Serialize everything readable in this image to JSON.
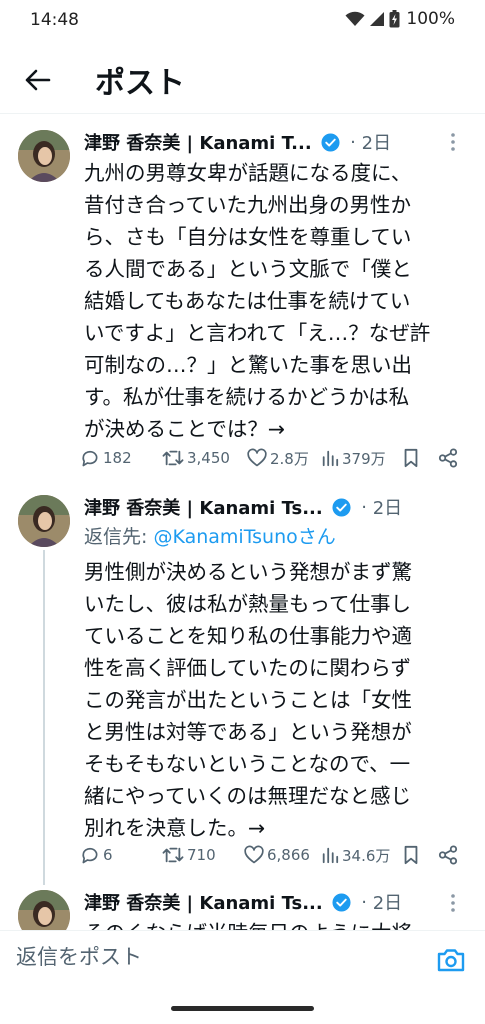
{
  "status_bar": {
    "time": "14:48",
    "battery": "100%"
  },
  "header": {
    "title": "ポスト"
  },
  "tweets": [
    {
      "author": "津野 香奈美 | Kanami T...",
      "time": "2日",
      "body": "九州の男尊女卑が話題になる度に、\n昔付き合っていた九州出身の男性か\nら、さも「自分は女性を尊重してい\nる人間である」という文脈で「僕と\n結婚してもあなたは仕事を続けてい\nいですよ」と言われて「え…？なぜ許\n可制なの…？」と驚いた事を思い出\nす。私が仕事を続けるかどうかは私\nが決めることでは？→",
      "replies": "182",
      "reposts": "3,450",
      "likes": "2.8万",
      "views": "379万"
    },
    {
      "author": "津野 香奈美 | Kanami Ts...",
      "time": "2日",
      "reply_prefix": "返信先: ",
      "reply_handle": "@KanamiTsunoさん",
      "body": "男性側が決めるという発想がまず驚\nいたし、彼は私が熱量もって仕事し\nていることを知り私の仕事能力や適\n性を高く評価していたのに関わらず\nこの発言が出たということは「女性\nと男性は対等である」という発想が\nそもそもないということなので、一\n緒にやっていくのは無理だなと感じ\n別れを決意した。→",
      "replies": "6",
      "reposts": "710",
      "likes": "6,866",
      "views": "34.6万"
    },
    {
      "author": "津野 香奈美 | Kanami Ts...",
      "time": "2日",
      "body_partial": "そのくならば当時毎日のように大将"
    }
  ],
  "dot_separator": "·",
  "reply_bar": {
    "placeholder": "返信をポスト"
  },
  "colors": {
    "accent": "#1d9bf0",
    "secondary_text": "#536471",
    "text": "#0f1419"
  },
  "icons": [
    "wifi-icon",
    "signal-icon",
    "battery-icon",
    "back-arrow-icon",
    "verified-badge-icon",
    "more-icon",
    "reply-icon",
    "repost-icon",
    "like-icon",
    "views-icon",
    "bookmark-icon",
    "share-icon",
    "camera-icon"
  ]
}
